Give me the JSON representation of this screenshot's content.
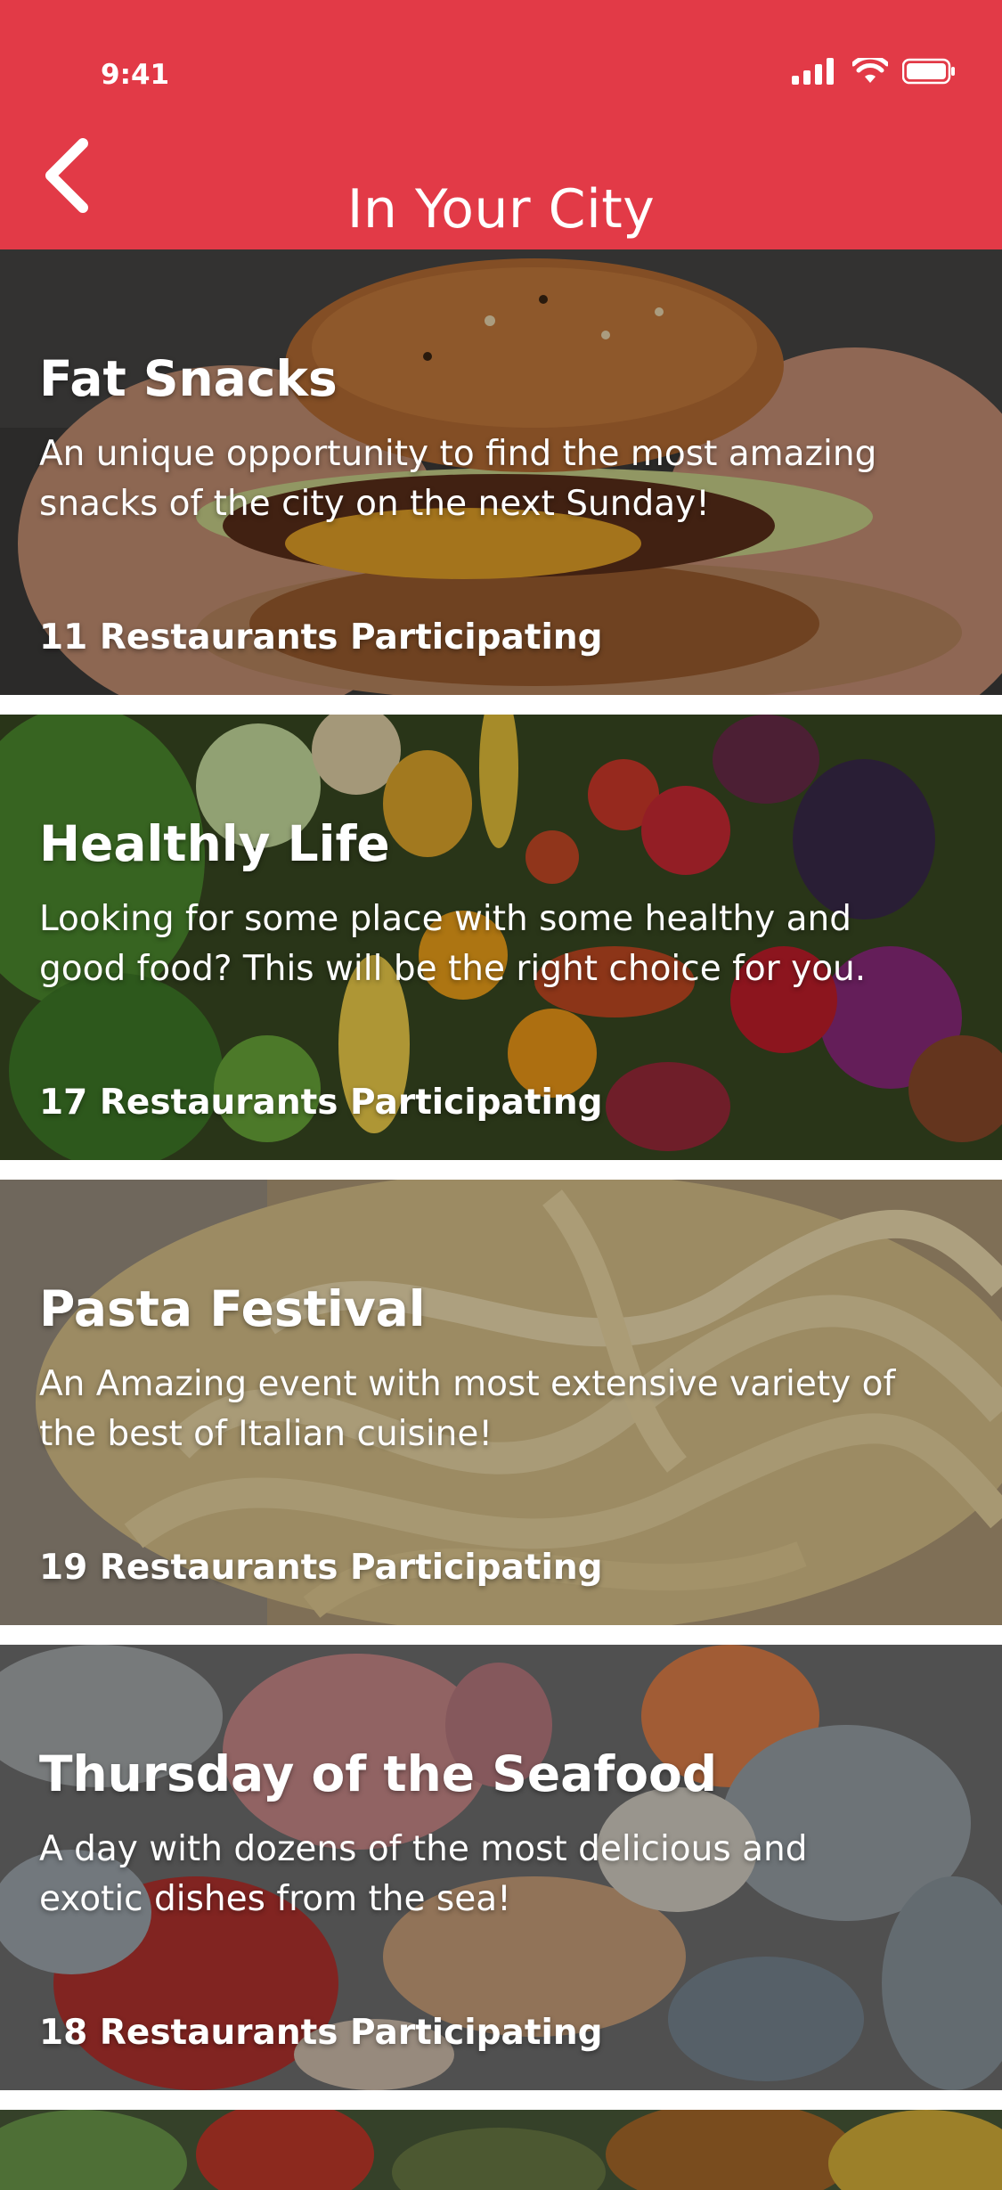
{
  "status_bar": {
    "time": "9:41",
    "icons": [
      "signal-icon",
      "wifi-icon",
      "battery-icon"
    ]
  },
  "navbar": {
    "title": "In Your City",
    "back_icon": "chevron-left-icon"
  },
  "colors": {
    "accent": "#e23a47",
    "text_on_image": "#ffffff"
  },
  "cards": [
    {
      "title": "Fat Snacks",
      "description": "An unique opportunity to find the most amazing snacks of the city on the next Sunday!",
      "count": "11 Restaurants Participating"
    },
    {
      "title": "Healthly Life",
      "description": "Looking for some place with some healthy and good food? This will be the right choice for you.",
      "count": "17 Restaurants Participating"
    },
    {
      "title": "Pasta Festival",
      "description": "An Amazing event with most extensive variety of the best of Italian cuisine!",
      "count": "19 Restaurants Participating"
    },
    {
      "title": "Thursday of the Seafood",
      "description": "A day with dozens of the most delicious and exotic dishes from the sea!",
      "count": "18 Restaurants Participating"
    }
  ]
}
